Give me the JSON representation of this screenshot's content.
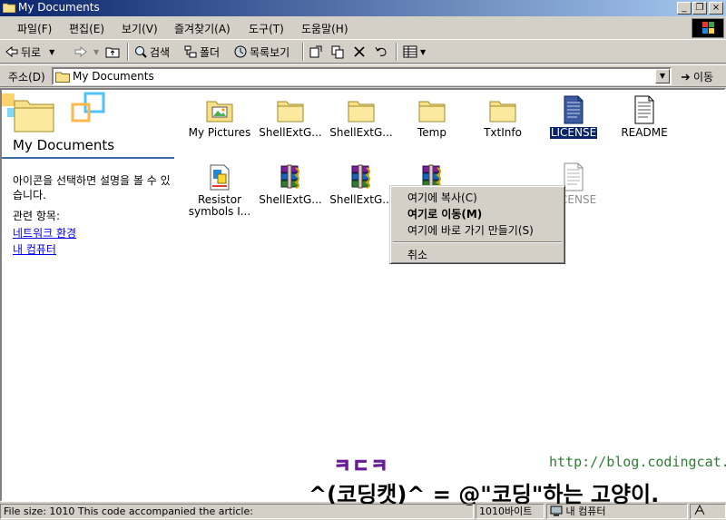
{
  "window": {
    "title": "My Documents",
    "minimize_glyph": "_",
    "restore_glyph": "❐",
    "close_glyph": "×"
  },
  "menu": [
    "파일(F)",
    "편집(E)",
    "보기(V)",
    "즐겨찾기(A)",
    "도구(T)",
    "도움말(H)"
  ],
  "toolbar": {
    "back": "뒤로",
    "search": "검색",
    "folders": "폴더",
    "history": "목록보기"
  },
  "address": {
    "label": "주소(D)",
    "value": "My Documents",
    "go": "이동"
  },
  "left_pane": {
    "title": "My Documents",
    "description": "아이콘을 선택하면 설명을 볼 수 있습니다.",
    "related_header": "관련 항목:",
    "links": [
      "네트워크 환경",
      "내 컴퓨터"
    ]
  },
  "files": [
    {
      "label": "My Pictures",
      "icon": "pictures-folder-icon"
    },
    {
      "label": "ShellExtG...",
      "icon": "folder-icon"
    },
    {
      "label": "ShellExtG...",
      "icon": "folder-icon"
    },
    {
      "label": "Temp",
      "icon": "folder-icon"
    },
    {
      "label": "TxtInfo",
      "icon": "folder-icon"
    },
    {
      "label": "LICENSE",
      "icon": "text-document-icon"
    },
    {
      "label": "README",
      "icon": "text-document-icon"
    },
    {
      "label": "Resistor symbols I...",
      "icon": "resistor-file-icon"
    },
    {
      "label": "ShellExtG...",
      "icon": "winrar-archive-icon"
    },
    {
      "label": "ShellExtG...",
      "icon": "winrar-archive-icon"
    },
    {
      "label": "",
      "icon": "winrar-archive-icon"
    },
    {
      "label": "LICENSE",
      "icon": "text-document-icon"
    }
  ],
  "context_menu": {
    "items": [
      "여기에 복사(C)",
      "여기로 이동(M)",
      "여기에 바로 가기 만들기(S)"
    ],
    "cancel": "취소"
  },
  "status": {
    "info": "File size: 1010 This code accompanied the article:",
    "size": "1010바이트",
    "location": "내 컴퓨터"
  },
  "watermark": {
    "top": "ㅋㄷㅋ",
    "url": "http://blog.codingcat.kr/",
    "line": "^(코딩캣)^ = @\"코딩\"하는 고양이."
  },
  "colors": {
    "title_active": "#0a246a",
    "selection": "#0a246a",
    "link": "#0000ee"
  }
}
